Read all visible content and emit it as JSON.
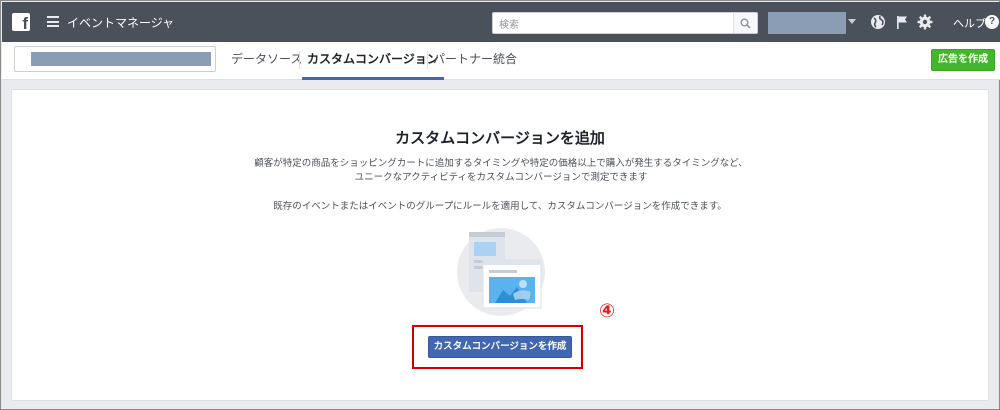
{
  "topbar": {
    "logo": "f",
    "title": "イベントマネージャ",
    "search_placeholder": "検索",
    "help_label": "ヘルプ",
    "help_icon": "?"
  },
  "nav": {
    "tabs": [
      {
        "label": "データソース"
      },
      {
        "label": "カスタムコンバージョン"
      },
      {
        "label": "パートナー統合"
      }
    ],
    "create_ad_label": "広告を作成"
  },
  "main": {
    "heading": "カスタムコンバージョンを追加",
    "description": "顧客が特定の商品をショッピングカートに追加するタイミングや特定の価格以上で購入が発生するタイミングなど、ユニークなアクティビティをカスタムコンバージョンで測定できます",
    "description2": "既存のイベントまたはイベントのグループにルールを適用して、カスタムコンバージョンを作成できます。",
    "step_marker": "④",
    "cta_label": "カスタムコンバージョンを作成"
  },
  "colors": {
    "topbar": "#4a515b",
    "primary_button": "#4267b2",
    "create_ad_button": "#42b72a",
    "highlight_box": "#d40000"
  },
  "icons": [
    "facebook-logo-icon",
    "menu-icon",
    "search-icon",
    "globe-icon",
    "flag-icon",
    "gear-icon",
    "help-icon"
  ]
}
